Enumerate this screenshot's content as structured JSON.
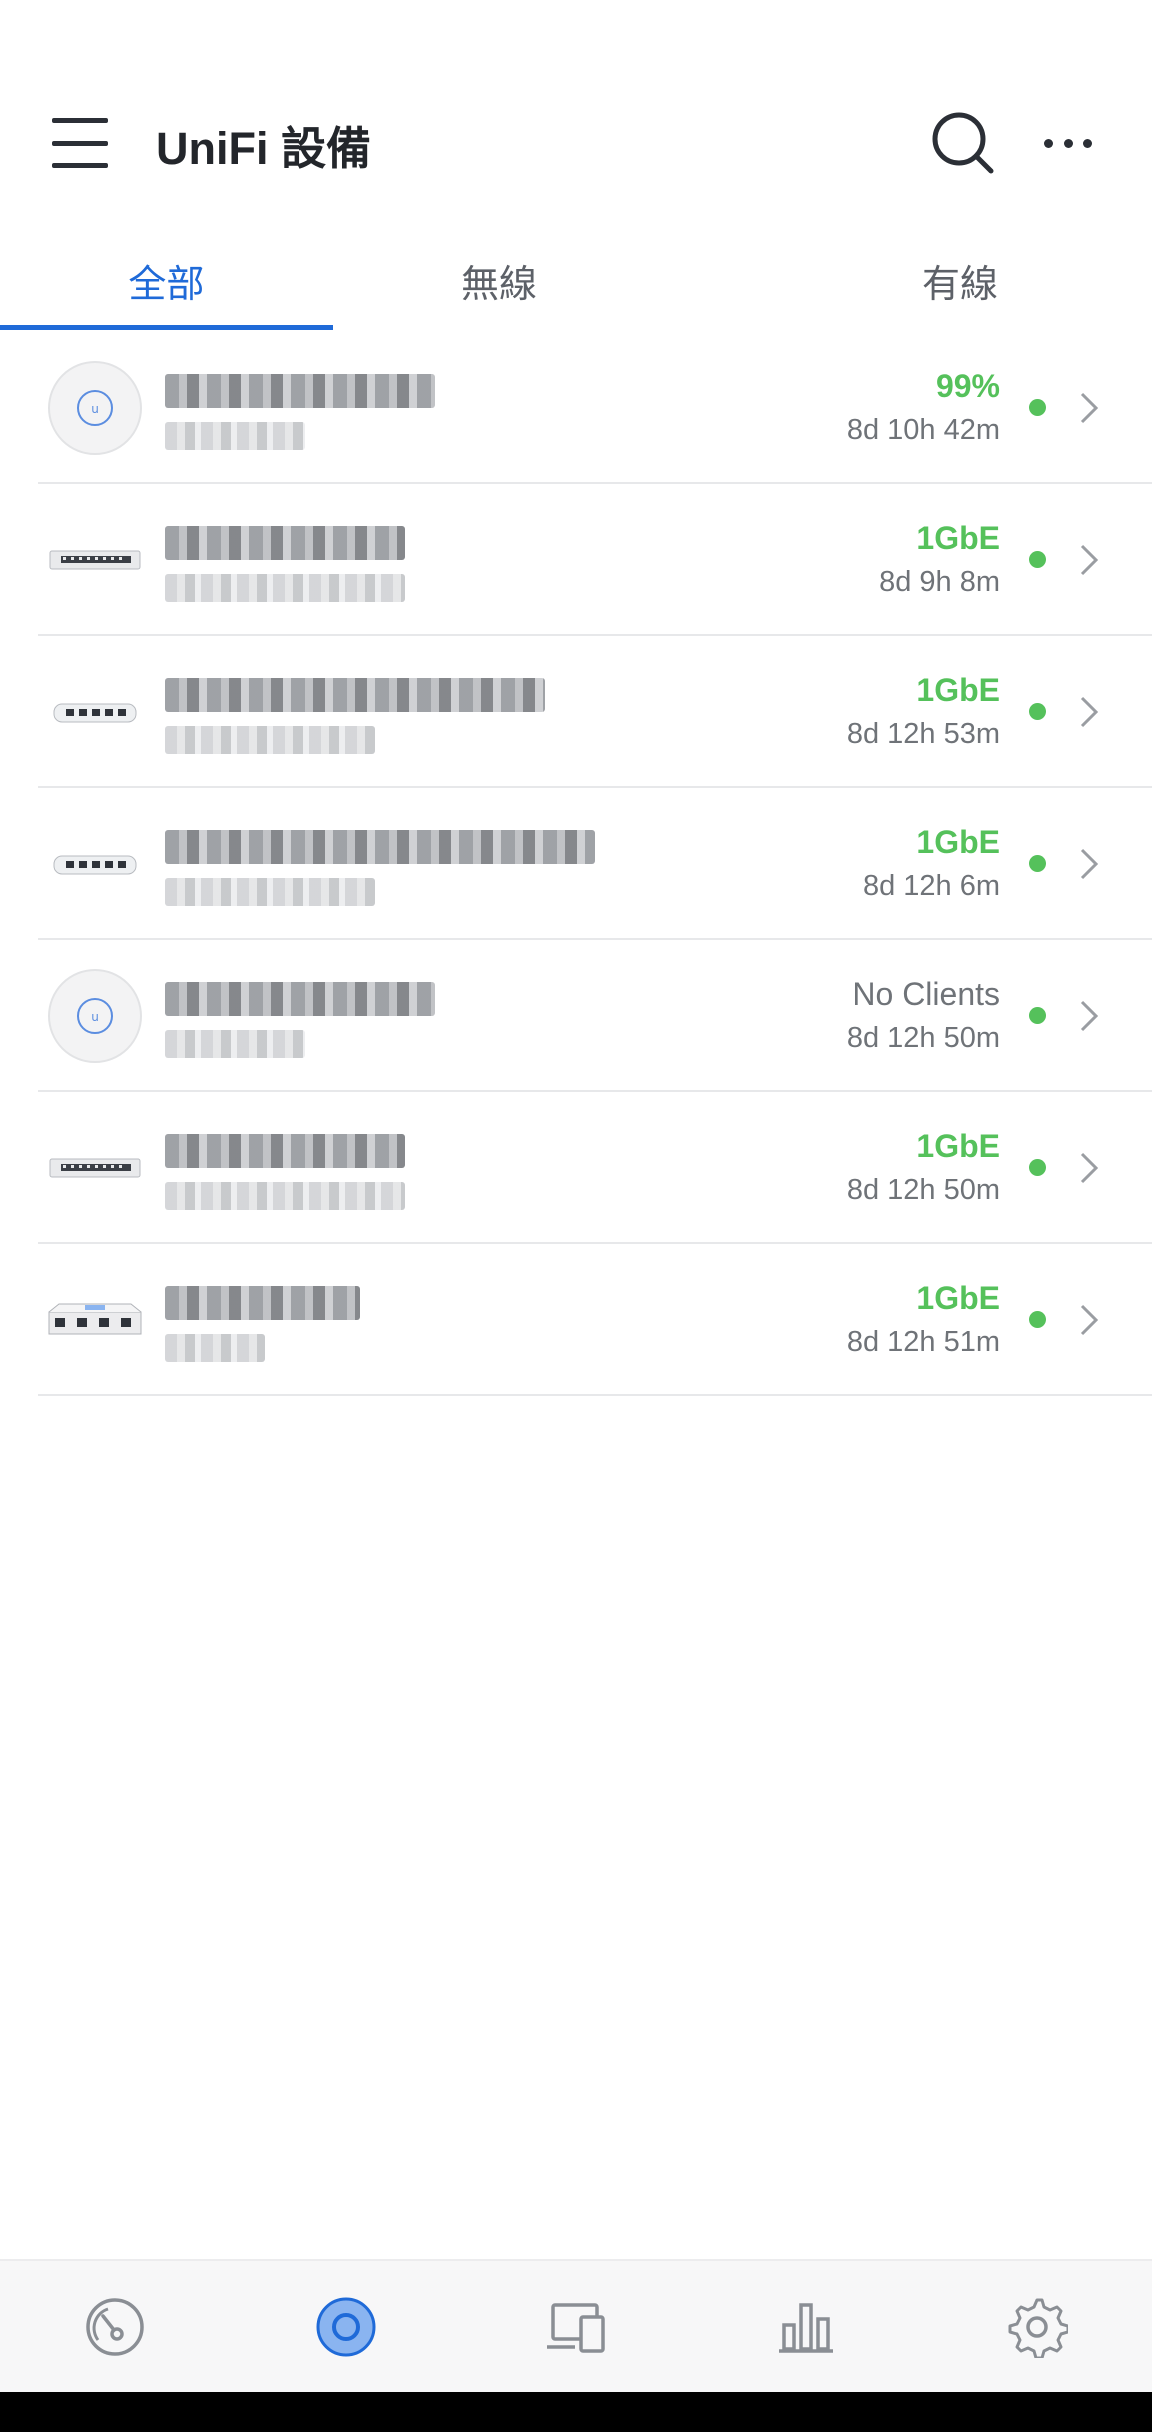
{
  "header": {
    "title": "UniFi 設備",
    "menu_icon": "hamburger-menu-icon",
    "search_icon": "search-icon",
    "more_icon": "more-horizontal-icon"
  },
  "tabs": [
    {
      "label": "全部",
      "active": true
    },
    {
      "label": "無線",
      "active": false
    },
    {
      "label": "有線",
      "active": false
    }
  ],
  "devices": [
    {
      "type": "access-point",
      "status": "99%",
      "status_color": "#55c15b",
      "uptime": "8d 10h 42m",
      "online": true
    },
    {
      "type": "switch-16",
      "status": "1GbE",
      "status_color": "#55c15b",
      "uptime": "8d 9h 8m",
      "online": true
    },
    {
      "type": "switch-5",
      "status": "1GbE",
      "status_color": "#55c15b",
      "uptime": "8d 12h 53m",
      "online": true
    },
    {
      "type": "switch-5",
      "status": "1GbE",
      "status_color": "#55c15b",
      "uptime": "8d 12h 6m",
      "online": true
    },
    {
      "type": "access-point",
      "status": "No Clients",
      "status_color": "#6f7378",
      "uptime": "8d 12h 50m",
      "online": true
    },
    {
      "type": "switch-16",
      "status": "1GbE",
      "status_color": "#55c15b",
      "uptime": "8d 12h 50m",
      "online": true
    },
    {
      "type": "gateway",
      "status": "1GbE",
      "status_color": "#55c15b",
      "uptime": "8d 12h 51m",
      "online": true
    }
  ],
  "bottom_nav": [
    {
      "icon": "dashboard-gauge-icon",
      "active": false
    },
    {
      "icon": "devices-circle-icon",
      "active": true
    },
    {
      "icon": "clients-icon",
      "active": false
    },
    {
      "icon": "statistics-icon",
      "active": false
    },
    {
      "icon": "settings-gear-icon",
      "active": false
    }
  ],
  "colors": {
    "accent": "#1f6ad8",
    "online": "#55c15b",
    "muted_text": "#6f7378"
  }
}
